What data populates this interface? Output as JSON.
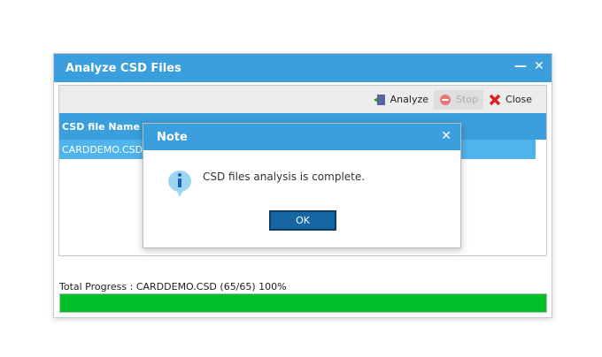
{
  "window": {
    "title": "Analyze CSD Files",
    "minimize_icon": "minimize-icon",
    "close_icon": "close-icon"
  },
  "toolbar": {
    "analyze_label": "Analyze",
    "stop_label": "Stop",
    "close_label": "Close"
  },
  "table": {
    "columns": [
      "CSD file Name"
    ],
    "rows": [
      [
        "CARDDEMO.CSD"
      ]
    ]
  },
  "progress": {
    "label": "Total Progress : CARDDEMO.CSD (65/65) 100%",
    "percent": 100,
    "color": "#00c02a"
  },
  "dialog": {
    "title": "Note",
    "message": "CSD files analysis is complete.",
    "ok_label": "OK",
    "icon": "info-icon"
  },
  "colors": {
    "accent": "#3a9fdc",
    "button": "#1566a3"
  }
}
